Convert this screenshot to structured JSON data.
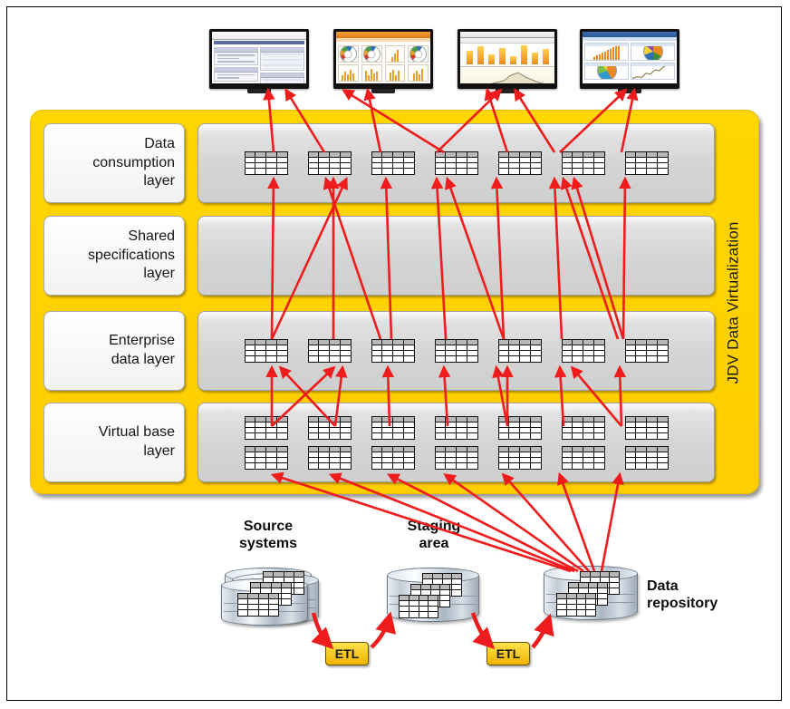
{
  "diagram": {
    "title": "JDV Data Virtualization reference architecture",
    "container_label": "JDV Data Virtualization",
    "accent_color": "#ffd600",
    "arrow_color": "#ee1c1c",
    "panel_color": "#d4d4d4",
    "frame_color": "#000000"
  },
  "layers": [
    {
      "id": "data-consumption-layer",
      "label": "Data\nconsumption\nlayer",
      "label_lines": [
        "Data",
        "consumption",
        "layer"
      ],
      "table_rows": 1,
      "tables_per_row": 7,
      "table_count": 7
    },
    {
      "id": "shared-specifications-layer",
      "label": "Shared\nspecifications\nlayer",
      "label_lines": [
        "Shared",
        "specifications",
        "layer"
      ],
      "table_rows": 0,
      "tables_per_row": 0,
      "table_count": 0
    },
    {
      "id": "enterprise-data-layer",
      "label": "Enterprise\ndata layer",
      "label_lines": [
        "Enterprise",
        "data layer"
      ],
      "table_rows": 1,
      "tables_per_row": 7,
      "table_count": 7
    },
    {
      "id": "virtual-base-layer",
      "label": "Virtual base\nlayer",
      "label_lines": [
        "Virtual base",
        "layer"
      ],
      "table_rows": 2,
      "tables_per_row": 7,
      "table_count": 14
    }
  ],
  "dashboards": [
    {
      "id": "dashboard-1",
      "kind": "report-form",
      "caption": ""
    },
    {
      "id": "dashboard-2",
      "kind": "gauge-dashboard",
      "caption": ""
    },
    {
      "id": "dashboard-3",
      "kind": "bar-and-area-dashboard",
      "caption": ""
    },
    {
      "id": "dashboard-4",
      "kind": "mixed-chart-dashboard",
      "caption": ""
    }
  ],
  "sources": [
    {
      "id": "source-systems",
      "label": "Source\nsystems",
      "label_lines": [
        "Source",
        "systems"
      ],
      "cylinders": 3,
      "label_position": "above"
    },
    {
      "id": "staging-area",
      "label": "Staging\narea",
      "label_lines": [
        "Staging",
        "area"
      ],
      "cylinders": 1,
      "label_position": "above"
    },
    {
      "id": "data-repository",
      "label": "Data\nrepository",
      "label_lines": [
        "Data",
        "repository"
      ],
      "cylinders": 1,
      "label_position": "right"
    }
  ],
  "etl_processes": [
    {
      "id": "etl-source-to-staging",
      "label": "ETL"
    },
    {
      "id": "etl-staging-to-repository",
      "label": "ETL"
    }
  ]
}
